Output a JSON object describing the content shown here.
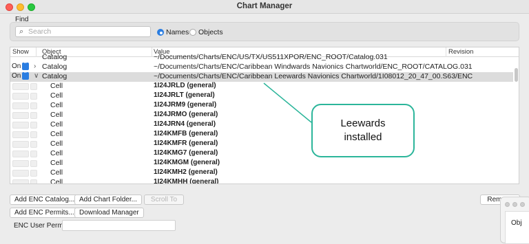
{
  "window": {
    "title": "Chart Manager"
  },
  "find": {
    "label": "Find",
    "search_placeholder": "Search",
    "radio_names": "Names",
    "radio_objects": "Objects",
    "selected": "Names"
  },
  "table": {
    "headers": {
      "show": "Show",
      "object": "Object",
      "value": "Value",
      "revision": "Revision"
    },
    "rows": [
      {
        "show": "",
        "object": "Catalog",
        "value": "~/Documents/Charts/ENC/US/TX/US511XPOR/ENC_ROOT/Catalog.031",
        "type": "partial"
      },
      {
        "show": "On",
        "object": "Catalog",
        "value": "~/Documents/Charts/ENC/Caribbean Windwards Navionics Chartworld/ENC_ROOT/CATALOG.031",
        "type": "catalog",
        "expanded": false
      },
      {
        "show": "On",
        "object": "Catalog",
        "value": "~/Documents/Charts/ENC/Caribbean Leewards Navionics Chartworld/1I08012_20_47_00.S63/ENC",
        "type": "catalog",
        "expanded": true,
        "selected": true
      },
      {
        "object": "Cell",
        "value": "1I24JRLD (general)",
        "type": "cell"
      },
      {
        "object": "Cell",
        "value": "1I24JRLT (general)",
        "type": "cell"
      },
      {
        "object": "Cell",
        "value": "1I24JRM9 (general)",
        "type": "cell"
      },
      {
        "object": "Cell",
        "value": "1I24JRMO (general)",
        "type": "cell"
      },
      {
        "object": "Cell",
        "value": "1I24JRN4 (general)",
        "type": "cell"
      },
      {
        "object": "Cell",
        "value": "1I24KMFB (general)",
        "type": "cell"
      },
      {
        "object": "Cell",
        "value": "1I24KMFR (general)",
        "type": "cell"
      },
      {
        "object": "Cell",
        "value": "1I24KMG7 (general)",
        "type": "cell"
      },
      {
        "object": "Cell",
        "value": "1I24KMGM (general)",
        "type": "cell"
      },
      {
        "object": "Cell",
        "value": "1I24KMH2 (general)",
        "type": "cell"
      },
      {
        "object": "Cell",
        "value": "1I24KMHH (general)",
        "type": "cell"
      }
    ]
  },
  "buttons": {
    "add_enc_catalog": "Add ENC Catalog...",
    "add_chart_folder": "Add Chart Folder...",
    "scroll_to": "Scroll To",
    "remove": "Remove",
    "add_enc_permits": "Add ENC Permits...",
    "download_manager": "Download Manager"
  },
  "permit": {
    "label": "ENC User Permit:",
    "value": ""
  },
  "annotation": {
    "line1": "Leewards",
    "line2": "installed",
    "color": "#2bb59a"
  },
  "mini_window": {
    "text": "Obj"
  },
  "colors": {
    "accent": "#2a7de1",
    "selected_row": "#dcdcdc"
  }
}
